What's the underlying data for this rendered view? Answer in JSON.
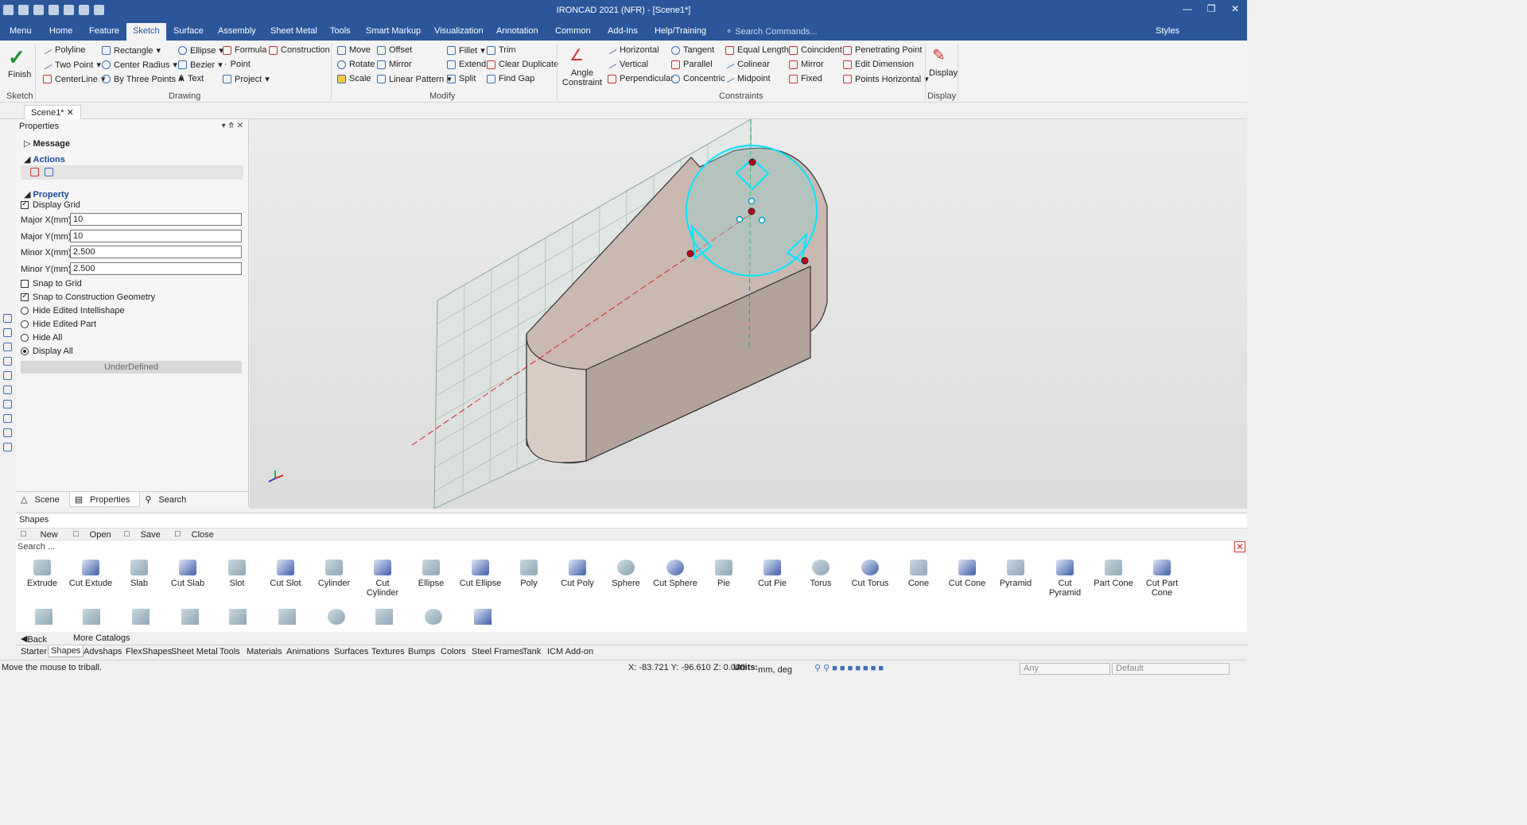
{
  "app": {
    "title": "IRONCAD 2021 (NFR) - [Scene1*]"
  },
  "menu_tabs": [
    "Menu",
    "Home",
    "Feature",
    "Sketch",
    "Surface",
    "Assembly",
    "Sheet Metal",
    "Tools",
    "Smart Markup",
    "Visualization",
    "Annotation",
    "Common",
    "Add-Ins",
    "Help/Training"
  ],
  "active_tab": "Sketch",
  "search_commands": "Search Commands...",
  "styles_label": "Styles",
  "ribbon": {
    "sketch": {
      "finish": "Finish",
      "group": "Sketch"
    },
    "drawing": {
      "group": "Drawing",
      "items": [
        "Polyline",
        "Rectangle",
        "Ellipse",
        "Formula",
        "Construction",
        "Two Point",
        "Center Radius",
        "Bezier",
        "Point",
        "CenterLine",
        "By Three Points",
        "Text",
        "Project"
      ]
    },
    "modify": {
      "group": "Modify",
      "items": [
        "Move",
        "Offset",
        "Fillet",
        "Trim",
        "Rotate",
        "Mirror",
        "Extend",
        "Clear Duplicate",
        "Scale",
        "Linear Pattern",
        "Split",
        "Find Gap"
      ]
    },
    "constraints": {
      "group": "Constraints",
      "angle": "Angle Constraint",
      "items": [
        "Horizontal",
        "Tangent",
        "Equal Length",
        "Coincident",
        "Penetrating Point",
        "Vertical",
        "Parallel",
        "Colinear",
        "Mirror",
        "Edit Dimension",
        "Perpendicular",
        "Concentric",
        "Midpoint",
        "Fixed",
        "Points Horizontal"
      ]
    },
    "display": {
      "group": "Display",
      "label": "Display"
    }
  },
  "doc_tab": "Scene1*",
  "properties": {
    "header": "Properties",
    "message": "Message",
    "actions": "Actions",
    "property": "Property",
    "display_grid": "Display Grid",
    "fields": [
      {
        "label": "Major X(mm)",
        "value": "10"
      },
      {
        "label": "Major Y(mm)",
        "value": "10"
      },
      {
        "label": "Minor X(mm)",
        "value": "2.500"
      },
      {
        "label": "Minor Y(mm)",
        "value": "2.500"
      }
    ],
    "snap_grid": "Snap to Grid",
    "snap_construction": "Snap to Construction Geometry",
    "radios": [
      "Hide Edited Intellishape",
      "Hide Edited Part",
      "Hide All",
      "Display All"
    ],
    "selected_radio": "Display All",
    "status": "UnderDefined",
    "tabs": [
      "Scene",
      "Properties",
      "Search"
    ]
  },
  "shapes": {
    "header": "Shapes",
    "buttons": [
      "New",
      "Open",
      "Save",
      "Close"
    ],
    "search": "Search ...",
    "items": [
      "Extrude",
      "Cut Extude",
      "Slab",
      "Cut Slab",
      "Slot",
      "Cut Slot",
      "Cylinder",
      "Cut Cylinder",
      "Ellipse",
      "Cut Ellipse",
      "Poly",
      "Cut Poly",
      "Sphere",
      "Cut Sphere",
      "Pie",
      "Cut Pie",
      "Torus",
      "Cut Torus",
      "Cone",
      "Cut Cone",
      "Pyramid",
      "Cut Pyramid",
      "Part Cone",
      "Cut Part Cone"
    ],
    "back": "Back",
    "more": "More Catalogs"
  },
  "catalogs": [
    "Starter",
    "Shapes",
    "Advshaps",
    "FlexShapes",
    "Sheet Metal",
    "Tools",
    "Materials",
    "Animations",
    "Surfaces",
    "Textures",
    "Bumps",
    "Colors",
    "Steel Frames",
    "Tank",
    "ICM Add-on"
  ],
  "active_catalog": "Shapes",
  "status_bar": {
    "message": "Move the mouse to triball.",
    "coords": "X: -83.721 Y: -96.610 Z: 0.000",
    "units_label": "Units:",
    "units": "mm, deg",
    "filter": "Any",
    "style": "Default"
  },
  "colors": {
    "brand": "#2b579a",
    "sketch": "#00e5ff",
    "part": "#c9b9b0"
  }
}
